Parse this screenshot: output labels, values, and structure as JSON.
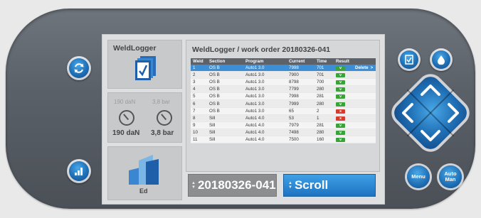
{
  "left_panel": {
    "app_name": "WeldLogger",
    "gauge1_label": "190 daN",
    "gauge2_label": "3,8 bar",
    "gauge1_value": "190 daN",
    "gauge2_value": "3,8 bar",
    "ed_label": "Ed"
  },
  "table_panel": {
    "title": "WeldLogger / work order 20180326-041",
    "headers": [
      "Weld",
      "Section",
      "Program",
      "Current",
      "Time",
      "Result"
    ],
    "rows": [
      {
        "weld": "1",
        "section": "OS B",
        "program": "Auto1 3.0",
        "current": "7998",
        "time": "701",
        "result": "v",
        "ok": true,
        "action": "Delete"
      },
      {
        "weld": "2",
        "section": "OS B",
        "program": "Auto1 3.0",
        "current": "7900",
        "time": "701",
        "result": "v",
        "ok": true,
        "action": ""
      },
      {
        "weld": "3",
        "section": "OS B",
        "program": "Auto1 3.0",
        "current": "8798",
        "time": "700",
        "result": "v",
        "ok": true,
        "action": ""
      },
      {
        "weld": "4",
        "section": "OS B",
        "program": "Auto1 3.0",
        "current": "7799",
        "time": "280",
        "result": "v",
        "ok": true,
        "action": ""
      },
      {
        "weld": "5",
        "section": "OS B",
        "program": "Auto1 3.0",
        "current": "7998",
        "time": "281",
        "result": "v",
        "ok": true,
        "action": ""
      },
      {
        "weld": "6",
        "section": "OS B",
        "program": "Auto1 3.0",
        "current": "7999",
        "time": "280",
        "result": "v",
        "ok": true,
        "action": ""
      },
      {
        "weld": "7",
        "section": "OS B",
        "program": "Auto1 3.0",
        "current": "65",
        "time": "2",
        "result": "x",
        "ok": false,
        "action": ""
      },
      {
        "weld": "8",
        "section": "Sill",
        "program": "Auto1 4.0",
        "current": "53",
        "time": "1",
        "result": "x",
        "ok": false,
        "action": ""
      },
      {
        "weld": "9",
        "section": "Sill",
        "program": "Auto1 4.0",
        "current": "7979",
        "time": "281",
        "result": "v",
        "ok": true,
        "action": ""
      },
      {
        "weld": "10",
        "section": "Sill",
        "program": "Auto1 4.0",
        "current": "7498",
        "time": "280",
        "result": "v",
        "ok": true,
        "action": ""
      },
      {
        "weld": "11",
        "section": "Sill",
        "program": "Auto1 4.0",
        "current": "7500",
        "time": "160",
        "result": "v",
        "ok": true,
        "action": ""
      }
    ],
    "delete_arrow": ">"
  },
  "work_order_field": "20180326-041",
  "scroll_field": "Scroll",
  "buttons": {
    "menu": "Menu",
    "auto": "Auto",
    "man": "Man"
  },
  "colors": {
    "accent_blue": "#1f6fb5",
    "selected_row": "#3c8fd6",
    "ok_green": "#3ba33a",
    "bad_red": "#d63b2f",
    "device_body": "#5b6169"
  }
}
